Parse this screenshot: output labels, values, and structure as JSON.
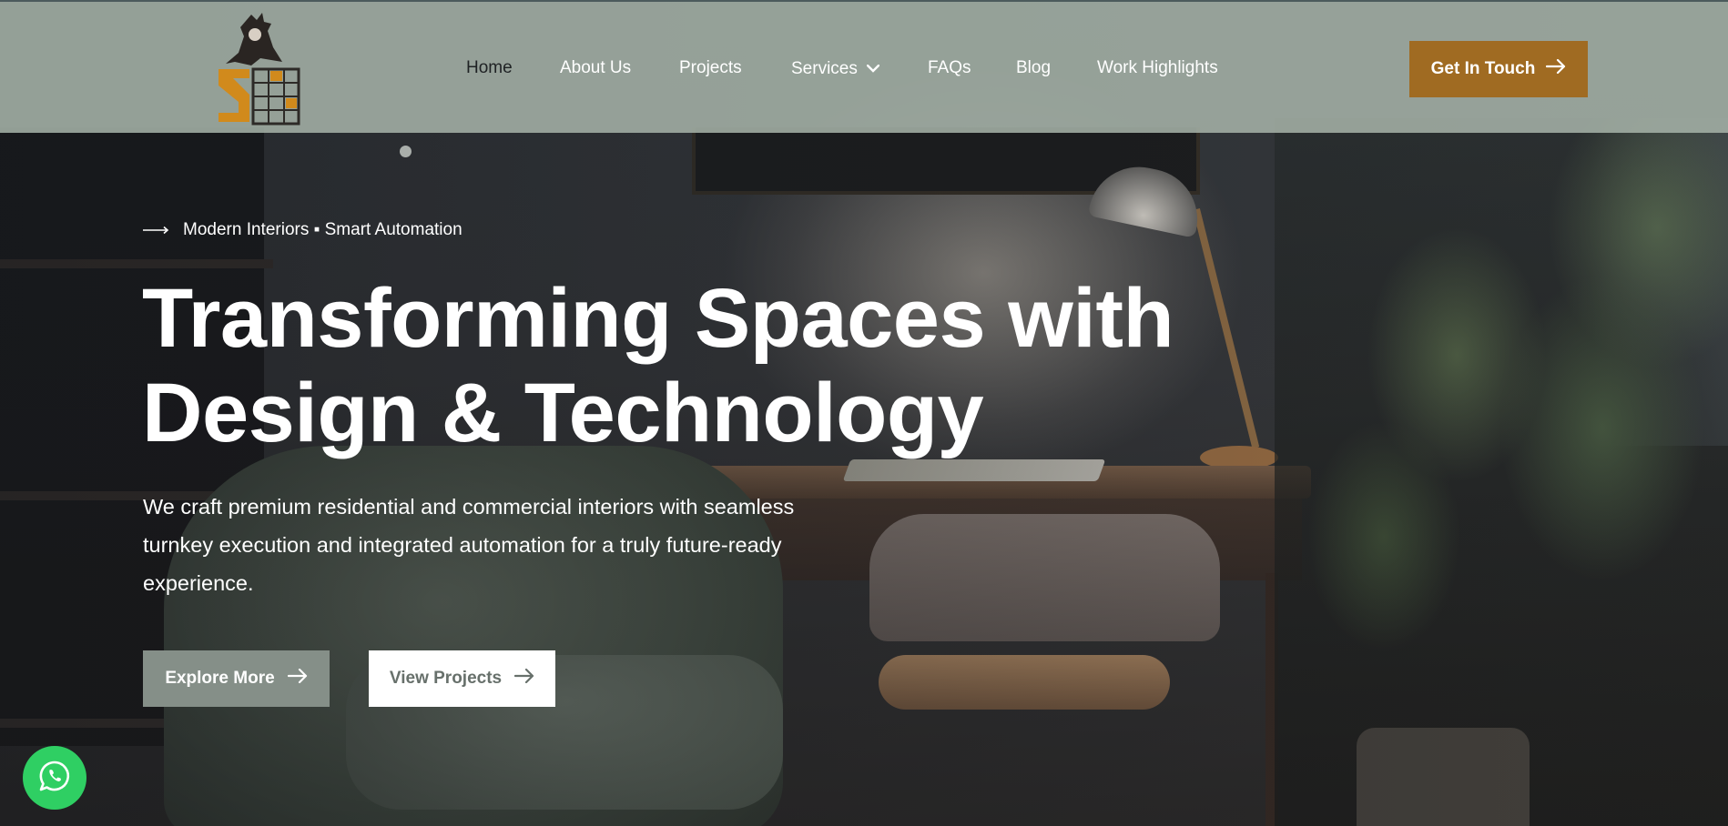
{
  "header": {
    "nav": [
      {
        "label": "Home",
        "active": true
      },
      {
        "label": "About Us"
      },
      {
        "label": "Projects"
      },
      {
        "label": "Services",
        "has_dropdown": true
      },
      {
        "label": "FAQs"
      },
      {
        "label": "Blog"
      },
      {
        "label": "Work Highlights"
      }
    ],
    "cta_label": "Get In Touch"
  },
  "hero": {
    "eyebrow": "Modern Interiors ▪ Smart Automation",
    "headline_line1": "Transforming Spaces with",
    "headline_line2": "Design & Technology",
    "lead": "We craft premium residential and commercial interiors with seamless turnkey execution and integrated automation for a truly future-ready experience.",
    "primary_button": "Explore More",
    "secondary_button": "View Projects"
  },
  "icons": {
    "arrow": "arrow-right-icon",
    "chevron": "chevron-down-icon",
    "whatsapp": "whatsapp-icon"
  },
  "colors": {
    "header_bg": "#a4b0a6",
    "cta_bg": "#a06b22",
    "primary_btn_bg": "#858f88",
    "whatsapp_green": "#2fcf63"
  }
}
